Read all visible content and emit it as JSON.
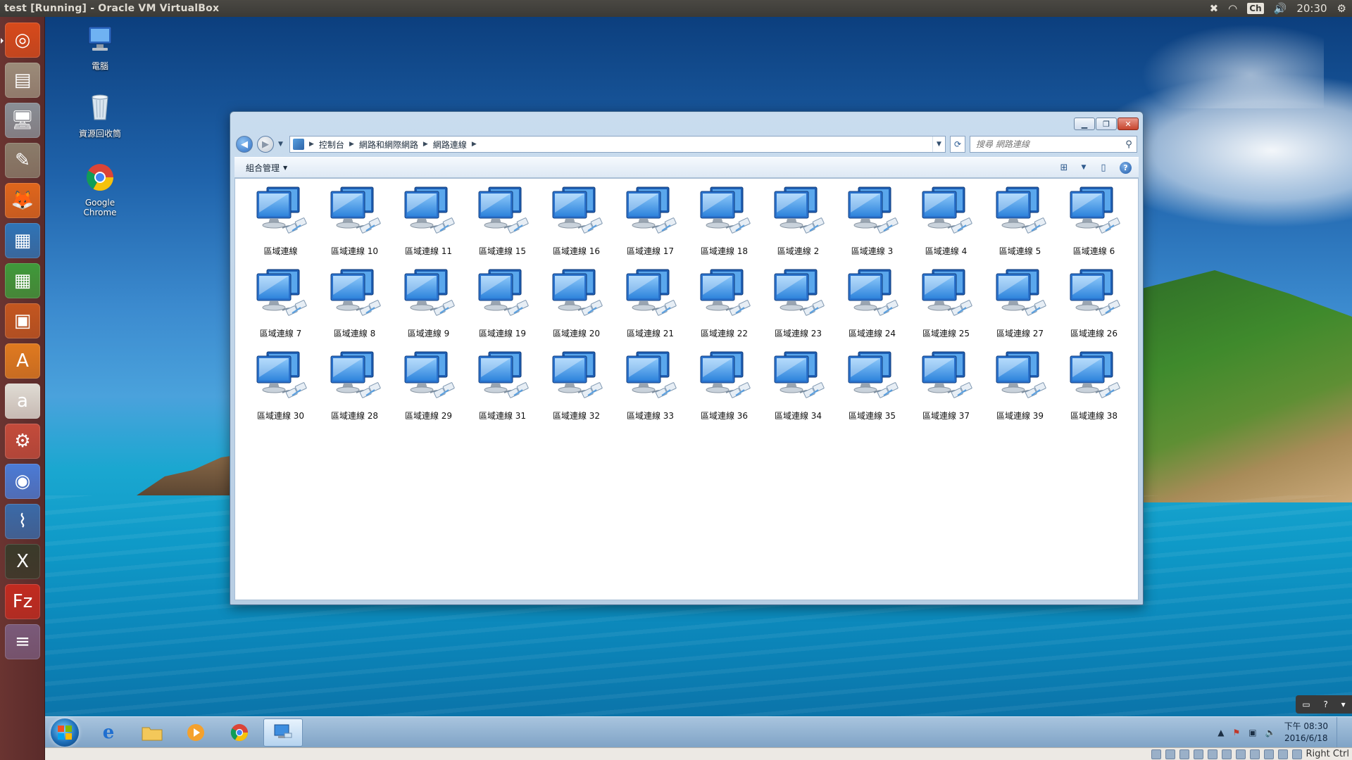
{
  "host": {
    "window_title": "test [Running] - Oracle VM VirtualBox",
    "top_clock": "20:30",
    "input_method": "Ch"
  },
  "launcher": {
    "items": [
      {
        "name": "ubuntu-dash-icon",
        "glyph": "◎",
        "color": "#d84a1b"
      },
      {
        "name": "files-icon",
        "glyph": "▤",
        "color": "#9c8c7a"
      },
      {
        "name": "remote-desktop-icon",
        "glyph": "🖥",
        "color": "#8a8f96"
      },
      {
        "name": "editor-icon",
        "glyph": "✎",
        "color": "#8b7c6a"
      },
      {
        "name": "firefox-icon",
        "glyph": "🦊",
        "color": "#e0661c"
      },
      {
        "name": "libreoffice-writer-icon",
        "glyph": "▦",
        "color": "#2f74b7"
      },
      {
        "name": "libreoffice-calc-icon",
        "glyph": "▦",
        "color": "#3f9a3a"
      },
      {
        "name": "libreoffice-impress-icon",
        "glyph": "▣",
        "color": "#c4561f"
      },
      {
        "name": "software-center-icon",
        "glyph": "A",
        "color": "#e07a1f"
      },
      {
        "name": "amazon-icon",
        "glyph": "a",
        "color": "#e0dcd4"
      },
      {
        "name": "system-settings-icon",
        "glyph": "⚙",
        "color": "#c44b3b"
      },
      {
        "name": "chromium-icon",
        "glyph": "◉",
        "color": "#4b7bd6"
      },
      {
        "name": "system-monitor-icon",
        "glyph": "⌇",
        "color": "#3a6aa8"
      },
      {
        "name": "xterm-icon",
        "glyph": "X",
        "color": "#3a3a2a"
      },
      {
        "name": "filezilla-icon",
        "glyph": "Fz",
        "color": "#c22b20"
      },
      {
        "name": "stacked-apps-icon",
        "glyph": "≡",
        "color": "#7a5a7a"
      }
    ]
  },
  "desktop_icons": [
    {
      "name": "computer-icon",
      "label": "電腦"
    },
    {
      "name": "recycle-bin-icon",
      "label": "資源回收筒"
    },
    {
      "name": "google-chrome-icon",
      "label": "Google Chrome"
    }
  ],
  "explorer": {
    "breadcrumb": [
      "控制台",
      "網路和網際網路",
      "網路連線"
    ],
    "search_placeholder": "搜尋 網路連線",
    "organize_label": "組合管理",
    "connections": [
      "區域連線",
      "區域連線 10",
      "區域連線 11",
      "區域連線 15",
      "區域連線 16",
      "區域連線 17",
      "區域連線 18",
      "區域連線 2",
      "區域連線 3",
      "區域連線 4",
      "區域連線 5",
      "區域連線 6",
      "區域連線 7",
      "區域連線 8",
      "區域連線 9",
      "區域連線 19",
      "區域連線 20",
      "區域連線 21",
      "區域連線 22",
      "區域連線 23",
      "區域連線 24",
      "區域連線 25",
      "區域連線 27",
      "區域連線 26",
      "區域連線 30",
      "區域連線 28",
      "區域連線 29",
      "區域連線 31",
      "區域連線 32",
      "區域連線 33",
      "區域連線 36",
      "區域連線 34",
      "區域連線 35",
      "區域連線 37",
      "區域連線 39",
      "區域連線 38"
    ]
  },
  "taskbar": {
    "clock_time": "下午 08:30",
    "clock_date": "2016/6/18"
  },
  "vbox_status": {
    "host_key": "Right Ctrl"
  }
}
